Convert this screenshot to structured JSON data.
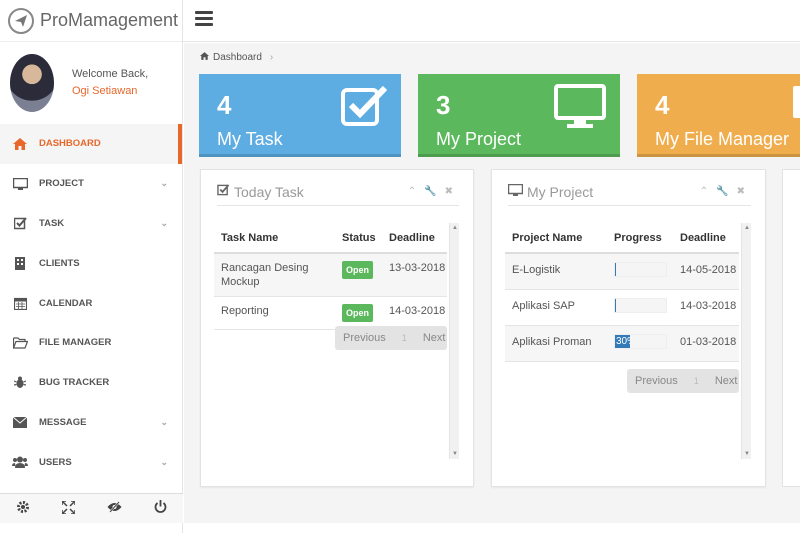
{
  "brand": {
    "name": "ProMamagement"
  },
  "profile": {
    "welcome": "Welcome Back,",
    "user_name": "Ogi Setiawan"
  },
  "menu": [
    {
      "label": "DASHBOARD",
      "icon": "home-icon",
      "active": true
    },
    {
      "label": "PROJECT",
      "icon": "monitor-icon",
      "chevron": true
    },
    {
      "label": "TASK",
      "icon": "check-square-icon",
      "chevron": true
    },
    {
      "label": "CLIENTS",
      "icon": "building-icon"
    },
    {
      "label": "CALENDAR",
      "icon": "calendar-icon"
    },
    {
      "label": "FILE MANAGER",
      "icon": "folder-open-icon"
    },
    {
      "label": "BUG TRACKER",
      "icon": "bug-icon"
    },
    {
      "label": "MESSAGE",
      "icon": "envelope-icon",
      "chevron": true
    },
    {
      "label": "USERS",
      "icon": "users-icon",
      "chevron": true
    }
  ],
  "breadcrumb": {
    "home": "Dashboard"
  },
  "stats": [
    {
      "number": "4",
      "label": "My Task",
      "color": "#5dade2",
      "icon": "check-square-icon"
    },
    {
      "number": "3",
      "label": "My Project",
      "color": "#5cb85c",
      "icon": "monitor-icon"
    },
    {
      "number": "4",
      "label": "My File Manager",
      "color": "#f0ad4e",
      "icon": "folder-icon"
    }
  ],
  "today_task": {
    "title": "Today Task",
    "columns": [
      "Task Name",
      "Status",
      "Deadline"
    ],
    "rows": [
      {
        "name": "Rancagan Desing Mockup",
        "status": "Open",
        "deadline": "13-03-2018"
      },
      {
        "name": "Reporting",
        "status": "Open",
        "deadline": "14-03-2018"
      }
    ],
    "pager": {
      "prev": "Previous",
      "page": "1",
      "next": "Next"
    }
  },
  "my_project": {
    "title": "My Project",
    "columns": [
      "Project Name",
      "Progress",
      "Deadline"
    ],
    "rows": [
      {
        "name": "E-Logistik",
        "progress": 0,
        "progress_label": "",
        "deadline": "14-05-2018"
      },
      {
        "name": "Aplikasi SAP",
        "progress": 0,
        "progress_label": "",
        "deadline": "14-03-2018"
      },
      {
        "name": "Aplikasi Proman",
        "progress": 0.3,
        "progress_label": "30%",
        "deadline": "01-03-2018"
      }
    ],
    "pager": {
      "prev": "Previous",
      "page": "1",
      "next": "Next"
    }
  }
}
